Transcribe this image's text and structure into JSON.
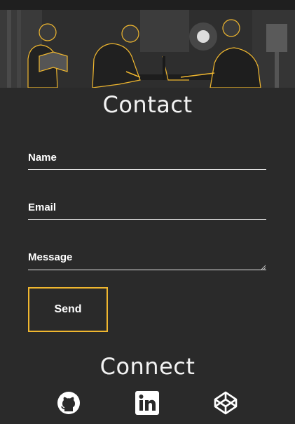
{
  "contact": {
    "title": "Contact",
    "fields": [
      {
        "label": "Name",
        "value": ""
      },
      {
        "label": "Email",
        "value": ""
      },
      {
        "label": "Message",
        "value": ""
      }
    ],
    "send_label": "Send"
  },
  "connect": {
    "title": "Connect",
    "links": [
      {
        "icon": "github-icon"
      },
      {
        "icon": "linkedin-icon"
      },
      {
        "icon": "codepen-icon"
      }
    ]
  },
  "colors": {
    "background": "#2a2a2a",
    "accent": "#f0b72f",
    "text": "#ffffff"
  }
}
